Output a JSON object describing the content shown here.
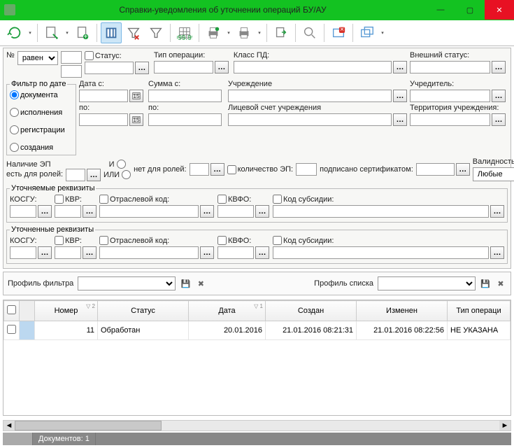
{
  "window": {
    "title": "Справки-уведомления об уточнении операций БУ/АУ"
  },
  "toolbar": {
    "icons": [
      "refresh",
      "edit",
      "new",
      "columns",
      "filter-clear",
      "filter",
      "grid",
      "print-green",
      "print",
      "export",
      "search",
      "close-red",
      "windows"
    ]
  },
  "filters": {
    "num_label": "№",
    "num_op": "равен",
    "status_label": "Статус:",
    "op_type_label": "Тип операции:",
    "class_pd_label": "Класс ПД:",
    "ext_status_label": "Внешний статус:",
    "date_filter": {
      "legend": "Фильтр по дате",
      "options": [
        "документа",
        "исполнения",
        "регистрации",
        "создания"
      ],
      "selected": 0
    },
    "date_from_label": "Дата с:",
    "date_to_label": "по:",
    "sum_from_label": "Сумма с:",
    "sum_to_label": "по:",
    "institution_label": "Учреждение",
    "account_label": "Лицевой счет учреждения",
    "founder_label": "Учредитель:",
    "territory_label": "Территория учреждения:",
    "ep_presence_label": "Наличие ЭП",
    "ep_has_roles_label": "есть для ролей:",
    "and_label": "И",
    "or_label": "ИЛИ",
    "ep_no_roles_label": "нет для ролей:",
    "ep_count_label": "количество ЭП:",
    "signed_cert_label": "подписано сертификатом:",
    "ep_validity_label": "Валидность ЭП",
    "ep_validity_value": "Любые",
    "refined": {
      "legend": "Уточняемые реквизиты",
      "kosgu": "КОСГУ:",
      "kvr": "КВР:",
      "branch_code": "Отраслевой код:",
      "kvfo": "КВФО:",
      "subsidy_code": "Код субсидии:"
    },
    "refined2": {
      "legend": "Уточненные реквизиты",
      "kosgu": "КОСГУ:",
      "kvr": "КВР:",
      "branch_code": "Отраслевой код:",
      "kvfo": "КВФО:",
      "subsidy_code": "Код субсидии:"
    }
  },
  "profile": {
    "filter_label": "Профиль фильтра",
    "list_label": "Профиль списка"
  },
  "grid": {
    "columns": [
      "",
      "",
      "Номер",
      "Статус",
      "Дата",
      "Создан",
      "Изменен",
      "Тип операци"
    ],
    "sort_markers": {
      "2": "▽ 2",
      "4": "▽ 1"
    },
    "rows": [
      {
        "num": "11",
        "status": "Обработан",
        "date": "20.01.2016",
        "created": "21.01.2016 08:21:31",
        "changed": "21.01.2016 08:22:56",
        "op": "НЕ УКАЗАНА"
      }
    ]
  },
  "statusbar": {
    "docs": "Документов: 1"
  }
}
